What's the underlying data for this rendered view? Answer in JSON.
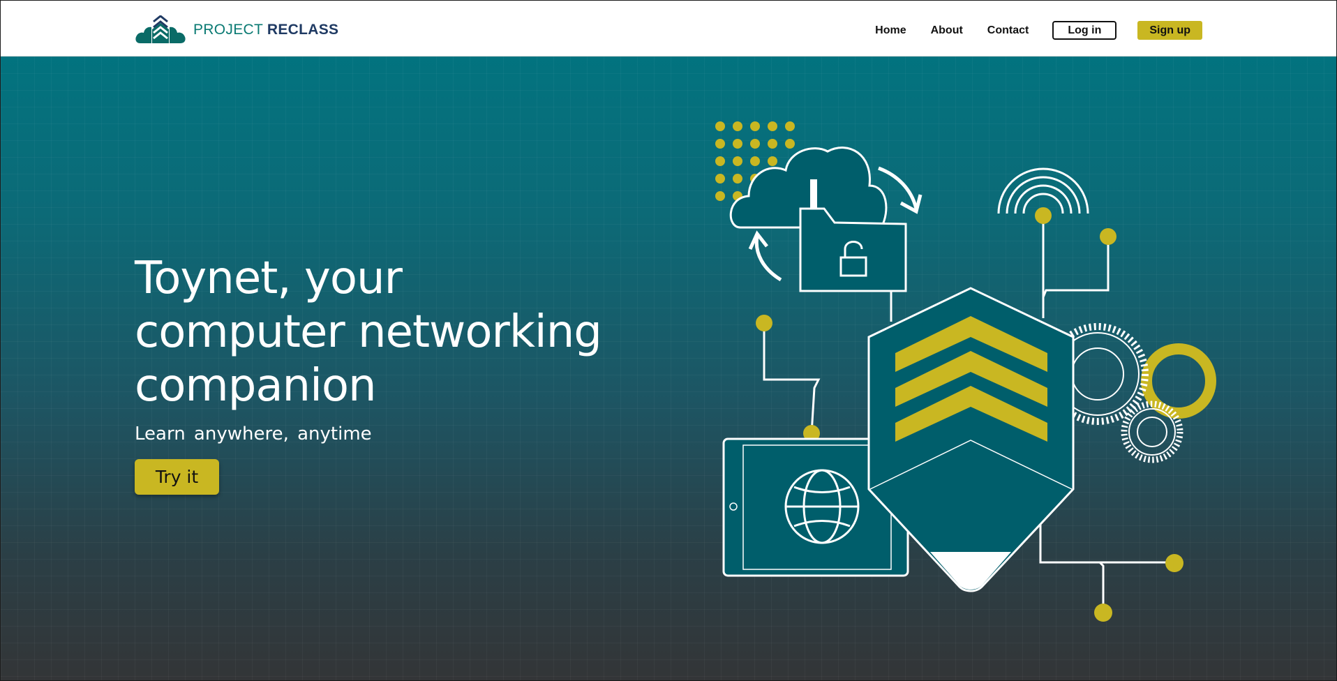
{
  "brand": {
    "name_light": "PROJECT",
    "name_bold": "RECLASS",
    "logo_icon": "cloud-chevron-icon"
  },
  "nav": {
    "links": [
      "Home",
      "About",
      "Contact"
    ],
    "login_label": "Log in",
    "signup_label": "Sign up"
  },
  "hero": {
    "headline_lines": [
      "Toynet, your",
      "computer networking",
      "companion"
    ],
    "subtitle": "Learn anywhere, anytime",
    "cta_label": "Try it"
  },
  "colors": {
    "accent": "#c9b722",
    "teal": "#005e6b",
    "brand_teal": "#0a7a73",
    "brand_navy": "#1f3a63"
  },
  "illustration_icons": [
    "cloud-folder-lock-icon",
    "wifi-signal-icon",
    "gears-icon",
    "tablet-globe-icon",
    "chevron-shield-icon",
    "dot-grid-icon"
  ]
}
